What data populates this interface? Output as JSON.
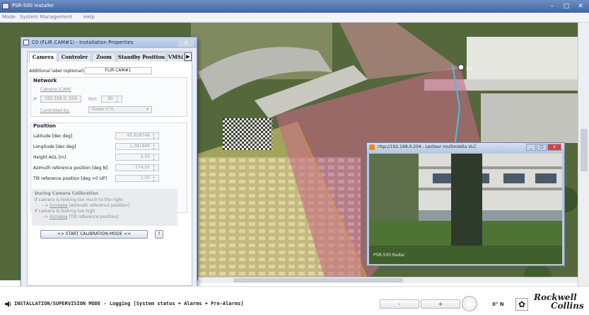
{
  "app": {
    "title": "PSR-500 Installer",
    "window_controls": [
      "–",
      "□",
      "✕"
    ]
  },
  "menubar": {
    "items": [
      "Mode",
      "System Management",
      "Help"
    ]
  },
  "dialog": {
    "title": "C0 (FLIR CAM#1) - Installation Properties",
    "tabs": [
      "Camera",
      "Controler",
      "Zoom",
      "Standby Position",
      "VMS("
    ],
    "active_tab": "Camera",
    "additional_label": {
      "label": "Additional label (optional)",
      "value": "FLIR CAM#1"
    },
    "network": {
      "header": "Network",
      "camera_link": "Camera (CAM)",
      "ip_label": "IP",
      "ip_value": "192.168.0 .204",
      "port_label": "Port",
      "port_value": "80",
      "controlled_by_label": "Controlled by:",
      "controlled_by_value": "Radar n°0"
    },
    "position": {
      "header": "Position",
      "rows": [
        {
          "label": "Latitude [dec deg]",
          "value": "45,628746"
        },
        {
          "label": "Longitude [dec deg]",
          "value": "1,381949"
        },
        {
          "label": "Height AGL [m]",
          "value": "2,50"
        },
        {
          "label": "Azimuth reference position [deg N]",
          "value": "174,55"
        },
        {
          "label": "Tilt reference position [deg >0 UP]",
          "value": "1,00"
        }
      ]
    },
    "calibration": {
      "title": "During Camera Calibration",
      "line1": "If camera is looking too much to the right",
      "line2_arrow": "--> ",
      "line2_link": "increase",
      "line2_rest": " [Azimuth reference position]",
      "line3": "If camera is looking too high",
      "line4_arrow": "--> ",
      "line4_link": "increase",
      "line4_rest": " [Tilt reference position]",
      "start_button": ">> START CALIBRATION MODE <<",
      "help_button": "?"
    }
  },
  "vlc": {
    "title": "rtsp://192.168.0.204 - Lecteur multimédia VLC",
    "watermark": "PSR-500 Radar",
    "controls": [
      "_",
      "□",
      "x"
    ]
  },
  "map": {
    "marker_label": "80"
  },
  "statusbar": {
    "mode_text": "INSTALLATION/SUPERVISION MODE - Logging [System status + Alarms + Pre-Alarms]",
    "minus_button": "-",
    "plus_button": "+",
    "heading": "0° N",
    "brand_line1": "Rockwell",
    "brand_line2": "Collins"
  }
}
